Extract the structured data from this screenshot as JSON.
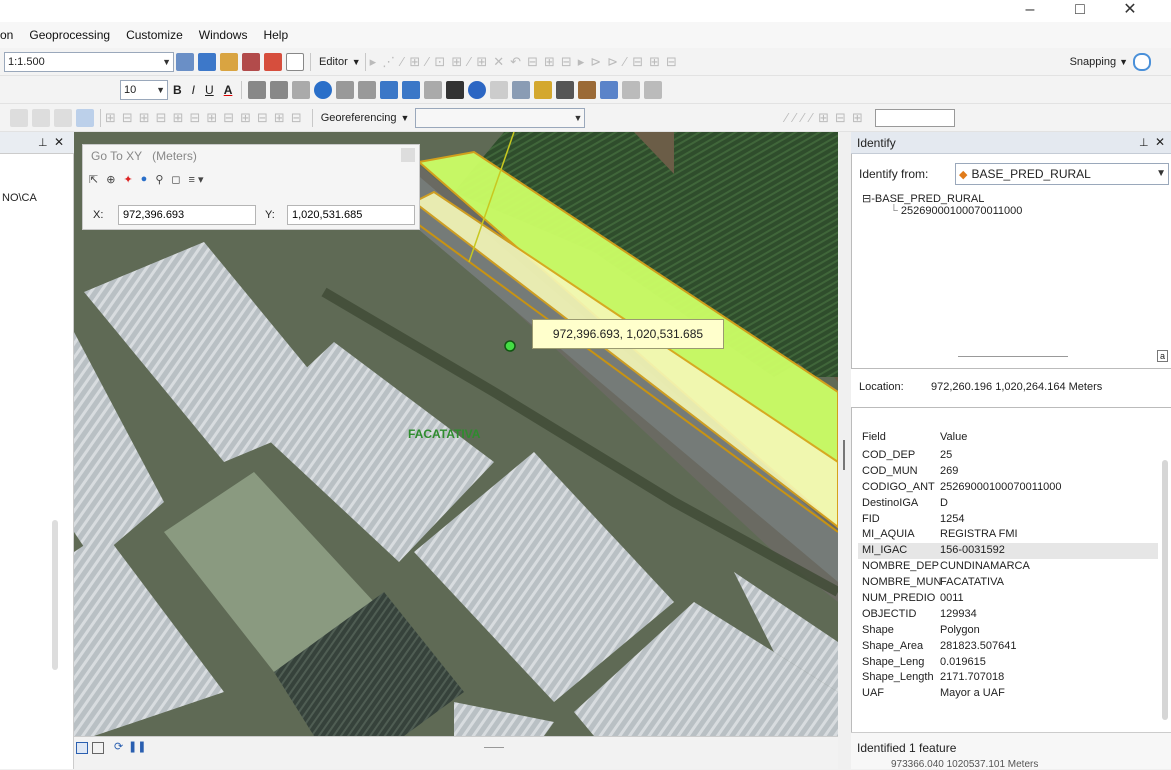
{
  "menu": [
    "on",
    "Geoprocessing",
    "Customize",
    "Windows",
    "Help"
  ],
  "toolbar": {
    "scale": "1:1.500",
    "font_size": "10",
    "editor_label": "Editor",
    "snapping_label": "Snapping",
    "georeferencing_label": "Georeferencing"
  },
  "left_panel": {
    "path_fragment": "NO\\CA"
  },
  "gotoxy": {
    "title": "Go To XY",
    "units": "(Meters)",
    "x_label": "X:",
    "x_value": "972,396.693",
    "y_label": "Y:",
    "y_value": "1,020,531.685"
  },
  "map": {
    "tooltip": "972,396.693, 1,020,531.685",
    "place_label": "FACATATIVA"
  },
  "identify": {
    "title": "Identify",
    "from_label": "Identify from:",
    "from_value": "BASE_PRED_RURAL",
    "tree_root": "BASE_PRED_RURAL",
    "tree_child": "25269000100070011000",
    "location_label": "Location:",
    "location_value": "972,260.196  1,020,264.164 Meters",
    "field_header": "Field",
    "value_header": "Value",
    "rows": [
      {
        "field": "COD_DEP",
        "value": "25"
      },
      {
        "field": "COD_MUN",
        "value": "269"
      },
      {
        "field": "CODIGO_ANT",
        "value": "25269000100070011000"
      },
      {
        "field": "DestinoIGA",
        "value": "D"
      },
      {
        "field": "FID",
        "value": "1254"
      },
      {
        "field": "MI_AQUIA",
        "value": "REGISTRA FMI"
      },
      {
        "field": "MI_IGAC",
        "value": "156-0031592"
      },
      {
        "field": "NOMBRE_DEP",
        "value": "CUNDINAMARCA"
      },
      {
        "field": "NOMBRE_MUN",
        "value": "FACATATIVA"
      },
      {
        "field": "NUM_PREDIO",
        "value": "0011"
      },
      {
        "field": "OBJECTID",
        "value": "129934"
      },
      {
        "field": "Shape",
        "value": "Polygon"
      },
      {
        "field": "Shape_Area",
        "value": "281823.507641"
      },
      {
        "field": "Shape_Leng",
        "value": "0.019615"
      },
      {
        "field": "Shape_Length",
        "value": "2171.707018"
      },
      {
        "field": "UAF",
        "value": "Mayor a UAF"
      }
    ],
    "footer": "Identified 1 feature",
    "footer_coords": "973366.040  1020537.101 Meters"
  }
}
